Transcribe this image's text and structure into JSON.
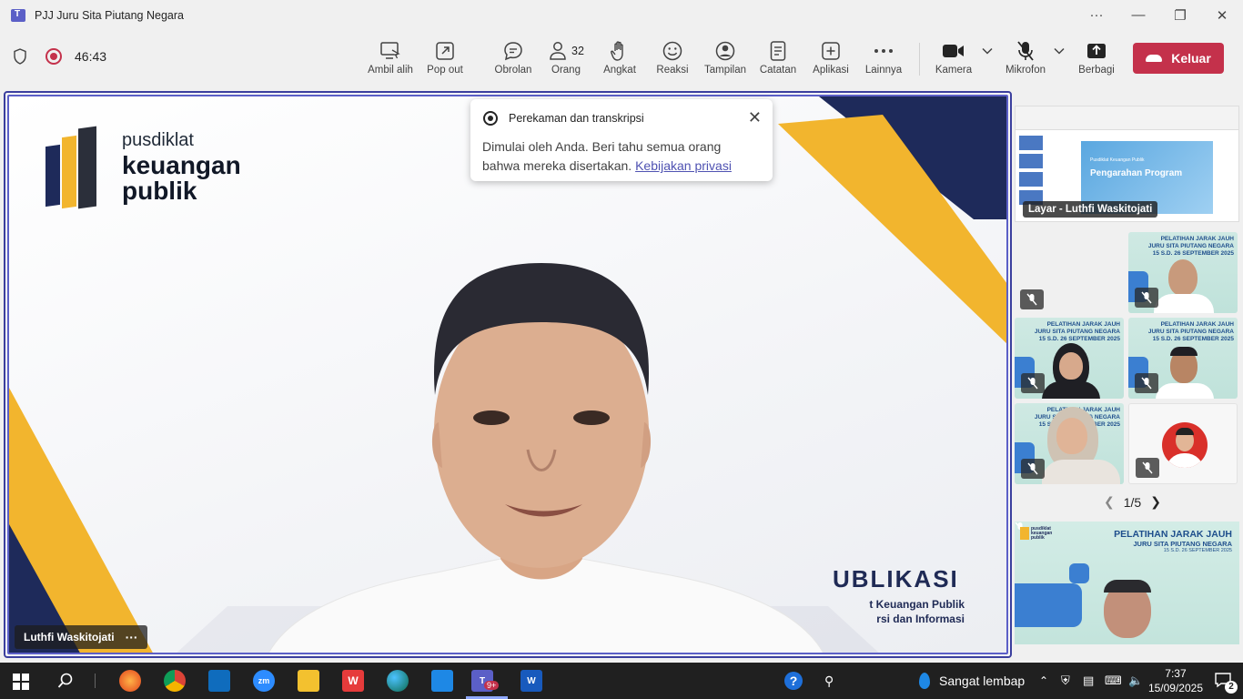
{
  "window": {
    "title": "PJJ Juru Sita Piutang Negara",
    "more_label": "···"
  },
  "toolbar": {
    "timer": "46:43",
    "buttons": [
      {
        "label": "Ambil alih"
      },
      {
        "label": "Pop out"
      },
      {
        "label": "Obrolan"
      },
      {
        "label": "Orang",
        "count": "32"
      },
      {
        "label": "Angkat"
      },
      {
        "label": "Reaksi"
      },
      {
        "label": "Tampilan"
      },
      {
        "label": "Catatan"
      },
      {
        "label": "Aplikasi"
      },
      {
        "label": "Lainnya"
      },
      {
        "label": "Kamera"
      },
      {
        "label": "Mikrofon"
      },
      {
        "label": "Berbagi"
      }
    ],
    "leave_label": "Keluar"
  },
  "stage": {
    "brand_line1": "pusdiklat",
    "brand_line2": "keuangan",
    "brand_line3": "publik",
    "backdrop_title": "UBLIKASI",
    "backdrop_sub1": "t Keuangan Publik",
    "backdrop_sub2": "rsi dan Informasi",
    "speaker_name": "Luthfi Waskitojati",
    "more_label": "···"
  },
  "toast": {
    "title": "Perekaman dan transkripsi",
    "body": "Dimulai oleh Anda. Beri tahu semua orang bahwa mereka disertakan.",
    "link": "Kebijakan privasi"
  },
  "sidebar": {
    "share_caption": "Layar - Luthfi Waskitojati",
    "share_slide_title": "Pengarahan Program",
    "share_slide_sub": "Pusdiklat Keuangan Publik",
    "tile_header1": "PELATIHAN JARAK JAUH",
    "tile_header2": "JURU SITA PIUTANG NEGARA",
    "tile_header3": "15 S.D. 26 SEPTEMBER 2025",
    "pager": "1/5",
    "big_tile": {
      "line1": "PELATIHAN JARAK JAUH",
      "line2": "JURU SITA PIUTANG NEGARA",
      "line3": "15 S.D. 26 SEPTEMBER 2025"
    }
  },
  "taskbar": {
    "teams_badge": "9+",
    "weather": "Sangat lembap",
    "time": "7:37",
    "date": "15/09/2025",
    "notifications": "2"
  },
  "colors": {
    "accent": "#5b5fc7",
    "leave": "#c4314b",
    "brand_yellow": "#f2b52e",
    "brand_navy": "#1e2a5a"
  }
}
